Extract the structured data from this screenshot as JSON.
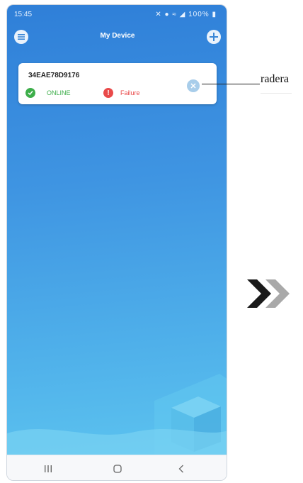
{
  "status_bar": {
    "time": "15:45",
    "battery": "100%"
  },
  "header": {
    "title": "My Device"
  },
  "device": {
    "id": "34EAE78D9176",
    "online_label": "ONLINE",
    "failure_label": "Failure"
  },
  "callout": {
    "label": "radera"
  },
  "icons": {
    "menu": "menu-icon",
    "add": "plus-icon",
    "online": "check-circle-icon",
    "failure": "exclamation-circle-icon",
    "delete": "close-circle-icon",
    "next": "double-chevron-right-icon"
  },
  "colors": {
    "online": "#3dae4a",
    "failure": "#e94a4a",
    "background_top": "#2f7fd8",
    "background_bottom": "#5cc3ef"
  }
}
